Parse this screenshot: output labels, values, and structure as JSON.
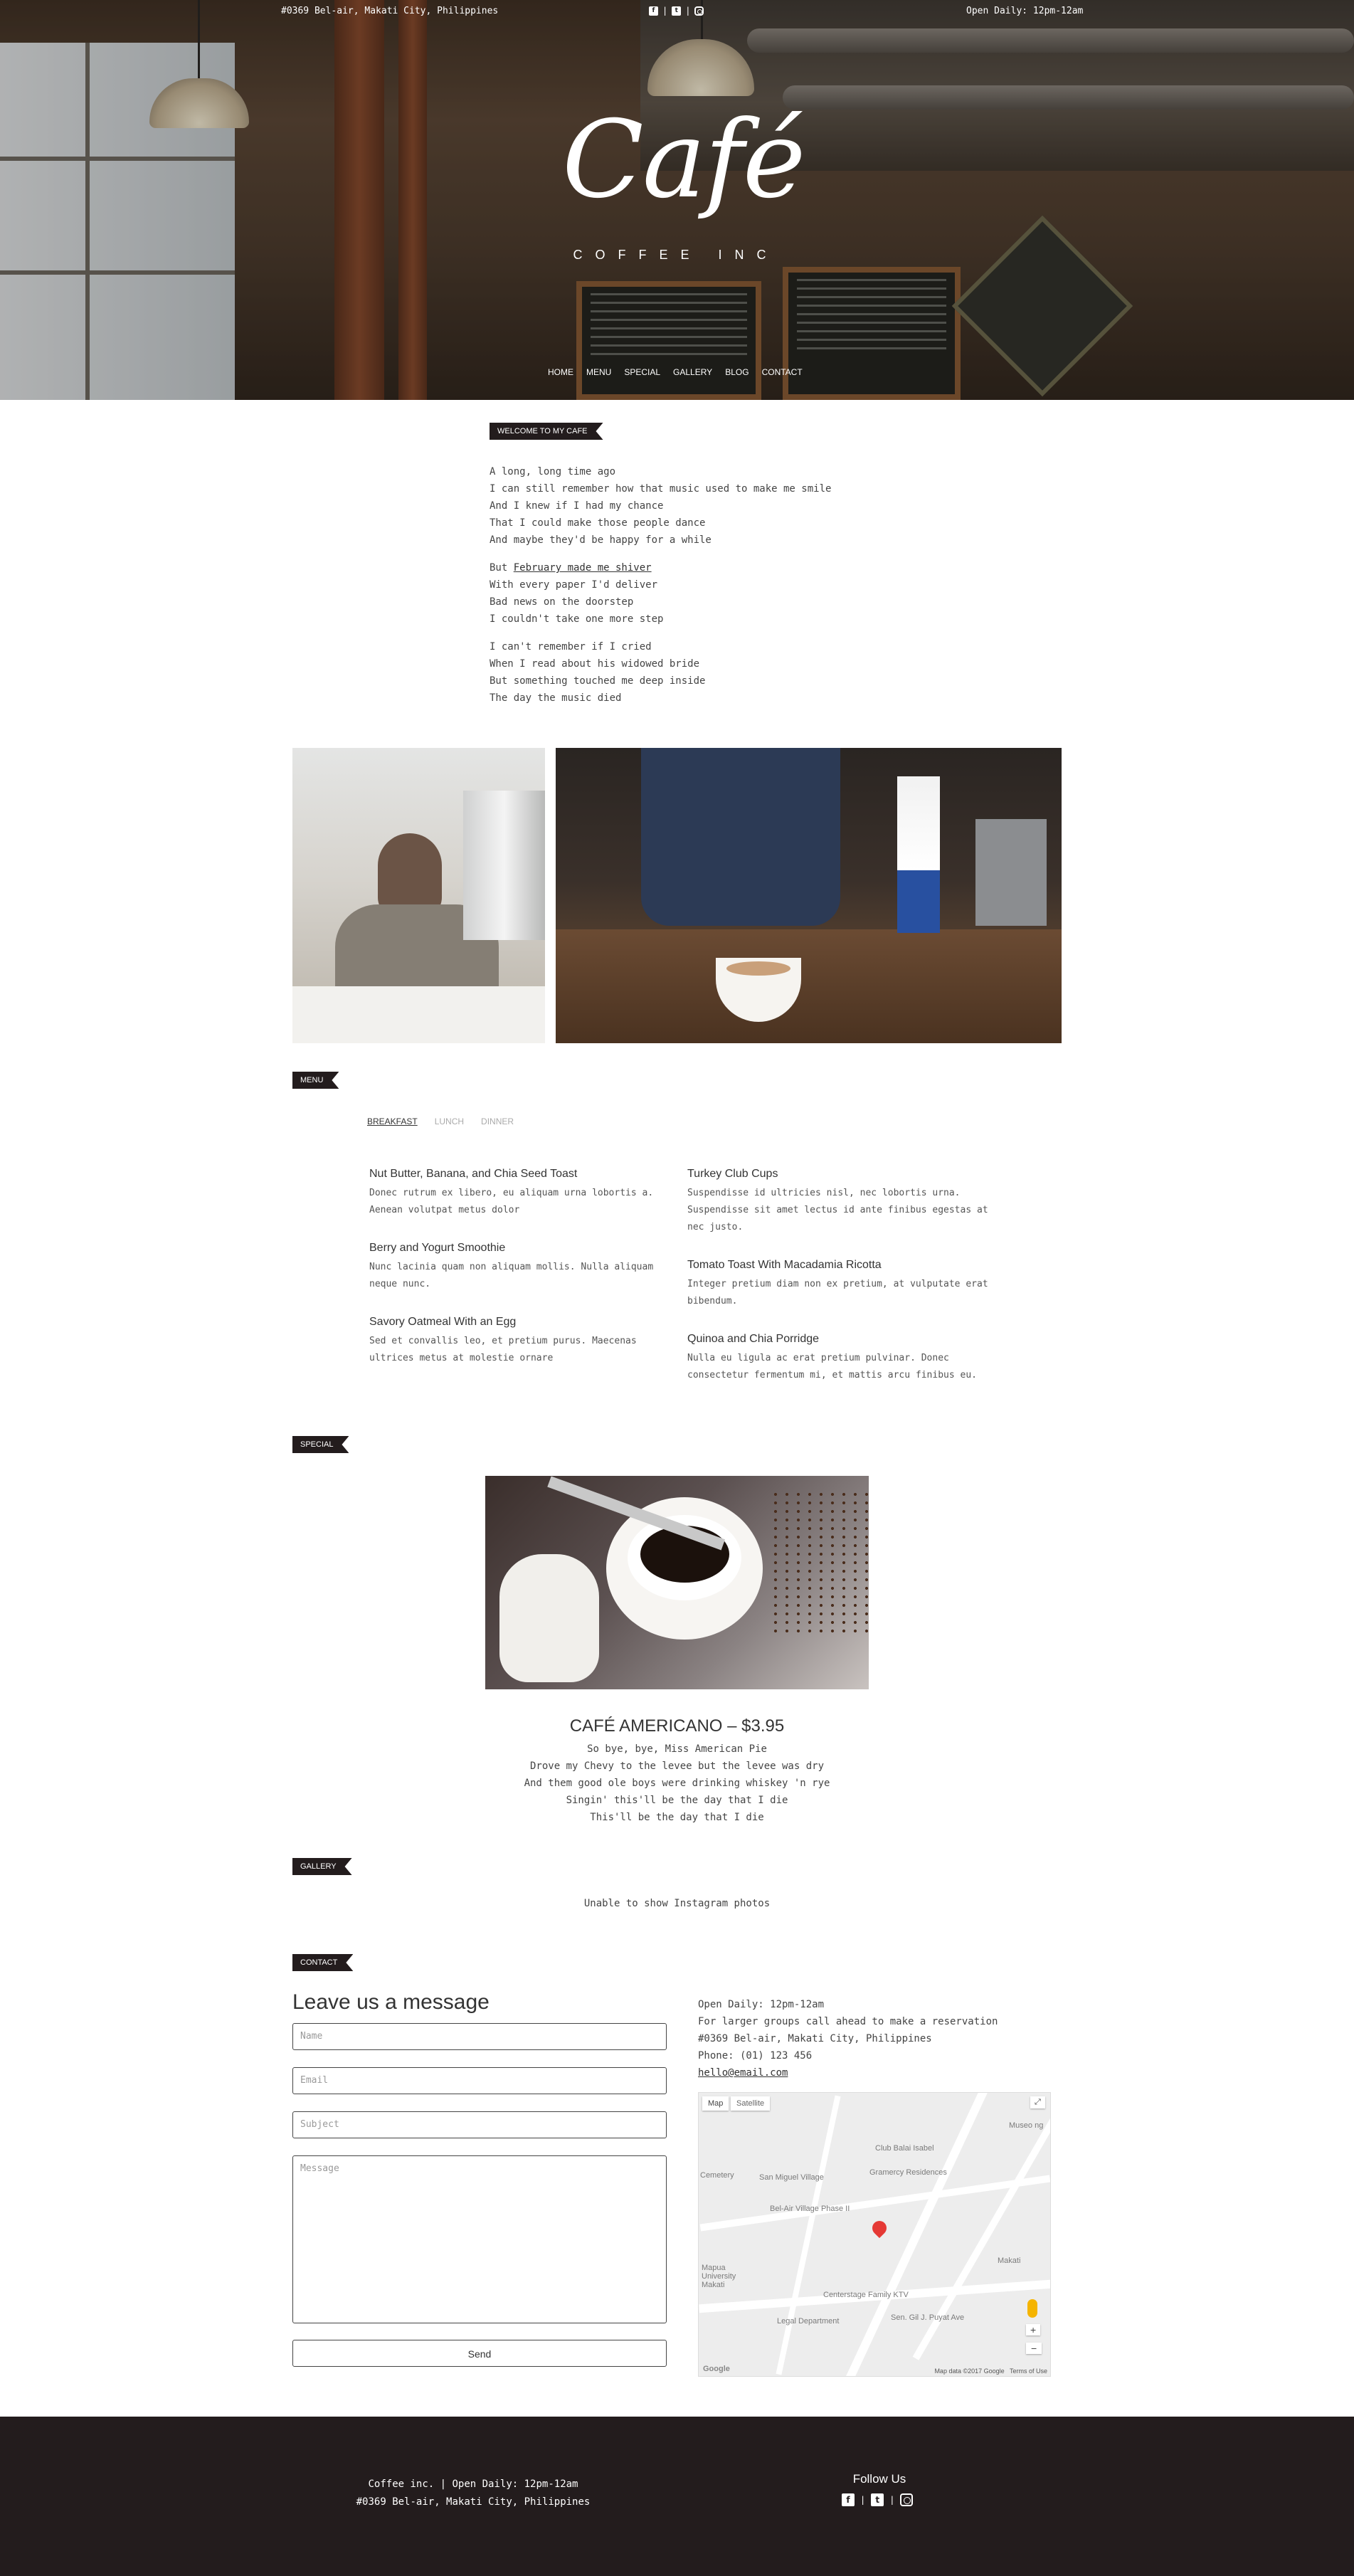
{
  "topbar": {
    "address": "#0369 Bel-air, Makati City, Philippines",
    "hours": "Open Daily: 12pm-12am",
    "separator": "|"
  },
  "brand": {
    "logo": "Café",
    "tagline": "COFFEE INC"
  },
  "nav": [
    "HOME",
    "MENU",
    "SPECIAL",
    "GALLERY",
    "BLOG",
    "CONTACT"
  ],
  "welcome": {
    "tag": "WELCOME TO MY CAFE",
    "stanza1": [
      "A long, long time ago",
      "I can still remember how that music used to make me smile",
      "And I knew if I had my chance",
      "That I could make those people dance",
      "And maybe they'd be happy for a while"
    ],
    "stanza2_prefix": "But ",
    "stanza2_link": "February made me shiver",
    "stanza2": [
      "With every paper I'd deliver",
      "Bad news on the doorstep",
      "I couldn't take one more step"
    ],
    "stanza3": [
      "I can't remember if I cried",
      "When I read about his widowed bride",
      "But something touched me deep inside",
      "The day the music died"
    ]
  },
  "menu": {
    "tag": "MENU",
    "tabs": [
      "BREAKFAST",
      "LUNCH",
      "DINNER"
    ],
    "items": [
      {
        "name": "Nut Butter, Banana, and Chia Seed Toast",
        "desc": "Donec rutrum ex libero, eu aliquam urna lobortis a. Aenean volutpat metus dolor"
      },
      {
        "name": "Berry and Yogurt Smoothie",
        "desc": "Nunc lacinia quam non aliquam mollis. Nulla aliquam neque nunc."
      },
      {
        "name": "Savory Oatmeal With an Egg",
        "desc": "Sed et convallis leo, et pretium purus. Maecenas ultrices metus at molestie ornare"
      },
      {
        "name": "Turkey Club Cups",
        "desc": "Suspendisse id ultricies nisl, nec lobortis urna. Suspendisse sit amet lectus id ante finibus egestas at nec justo."
      },
      {
        "name": "Tomato Toast With Macadamia Ricotta",
        "desc": "Integer pretium diam non ex pretium, at vulputate erat bibendum."
      },
      {
        "name": "Quinoa and Chia Porridge",
        "desc": "Nulla eu ligula ac erat pretium pulvinar. Donec consectetur fermentum mi, et mattis arcu finibus eu."
      }
    ]
  },
  "special": {
    "tag": "SPECIAL",
    "title": "CAFÉ AMERICANO – $3.95",
    "lines": [
      "So bye, bye, Miss American Pie",
      "Drove my Chevy to the levee but the levee was dry",
      "And them good ole boys were drinking whiskey 'n rye",
      "Singin' this'll be the day that I die",
      "This'll be the day that I die"
    ]
  },
  "gallery": {
    "tag": "GALLERY",
    "message": "Unable to show Instagram photos"
  },
  "contact": {
    "tag": "CONTACT",
    "heading": "Leave us a message",
    "fields": {
      "name": "Name",
      "email": "Email",
      "subject": "Subject",
      "message": "Message"
    },
    "send": "Send",
    "info": [
      "Open Daily: 12pm-12am",
      "For larger groups call ahead to make a reservation",
      "#0369 Bel-air, Makati City, Philippines",
      "Phone: (01) 123 456"
    ],
    "email": "hello@email.com",
    "map": {
      "map_btn": "Map",
      "satellite_btn": "Satellite",
      "labels": [
        "Club Balai Isabel",
        "San Miguel Village",
        "Gramercy Residences",
        "Bel-Air Village Phase II",
        "Centerstage Family KTV",
        "Legal Department",
        "Mapua University Makati",
        "Cemetery",
        "Sen. Gil J. Puyat Ave",
        "Makati",
        "Museo ng"
      ],
      "attribution": "Map data ©2017 Google",
      "terms": "Terms of Use",
      "logo": "Google"
    }
  },
  "footer": {
    "line1": "Coffee inc. | Open Daily: 12pm-12am",
    "line2": "#0369 Bel-air, Makati City, Philippines",
    "follow": "Follow Us"
  },
  "icons": {
    "facebook": "facebook-icon",
    "twitter": "twitter-icon",
    "instagram": "instagram-icon"
  }
}
